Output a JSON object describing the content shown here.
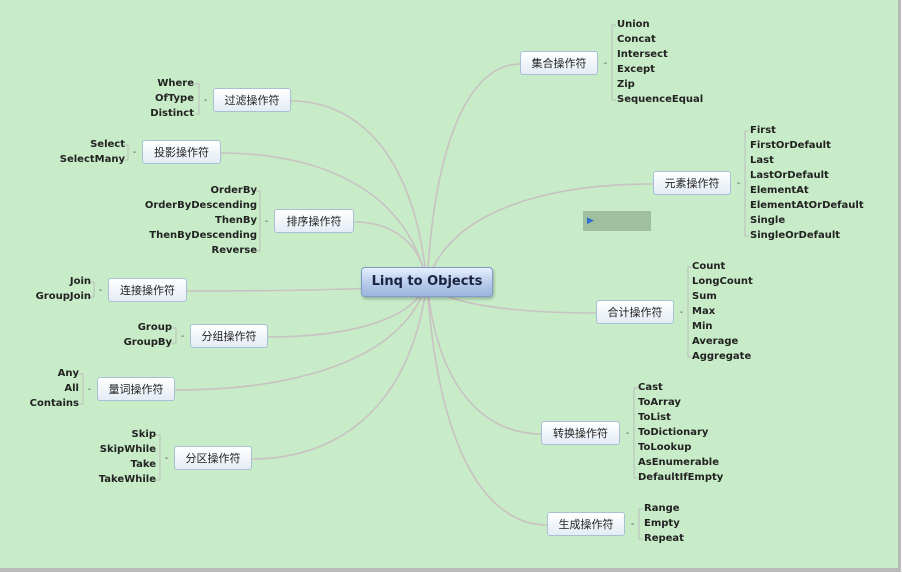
{
  "root": {
    "label": "Linq to Objects"
  },
  "branches": [
    {
      "id": "filter",
      "label": "过滤操作符",
      "side": "left",
      "children": [
        "Where",
        "OfType",
        "Distinct"
      ]
    },
    {
      "id": "projection",
      "label": "投影操作符",
      "side": "left",
      "children": [
        "Select",
        "SelectMany"
      ]
    },
    {
      "id": "sort",
      "label": "排序操作符",
      "side": "left",
      "children": [
        "OrderBy",
        "OrderByDescending",
        "ThenBy",
        "ThenByDescending",
        "Reverse"
      ]
    },
    {
      "id": "join",
      "label": "连接操作符",
      "side": "left",
      "children": [
        "Join",
        "GroupJoin"
      ]
    },
    {
      "id": "group",
      "label": "分组操作符",
      "side": "left",
      "children": [
        "Group",
        "GroupBy"
      ]
    },
    {
      "id": "quantifier",
      "label": "量词操作符",
      "side": "left",
      "children": [
        "Any",
        "All",
        "Contains"
      ]
    },
    {
      "id": "partition",
      "label": "分区操作符",
      "side": "left",
      "children": [
        "Skip",
        "SkipWhile",
        "Take",
        "TakeWhile"
      ]
    },
    {
      "id": "set",
      "label": "集合操作符",
      "side": "right",
      "children": [
        "Union",
        "Concat",
        "Intersect",
        "Except",
        "Zip",
        "SequenceEqual"
      ]
    },
    {
      "id": "element",
      "label": "元素操作符",
      "side": "right",
      "children": [
        "First",
        "FirstOrDefault",
        "Last",
        "LastOrDefault",
        "ElementAt",
        "ElementAtOrDefault",
        "Single",
        "SingleOrDefault"
      ]
    },
    {
      "id": "aggregate",
      "label": "合计操作符",
      "side": "right",
      "children": [
        "Count",
        "LongCount",
        "Sum",
        "Max",
        "Min",
        "Average",
        "Aggregate"
      ]
    },
    {
      "id": "conversion",
      "label": "转换操作符",
      "side": "right",
      "children": [
        "Cast",
        "ToArray",
        "ToList",
        "ToDictionary",
        "ToLookup",
        "AsEnumerable",
        "DefaultIfEmpty"
      ]
    },
    {
      "id": "generation",
      "label": "生成操作符",
      "side": "right",
      "children": [
        "Range",
        "Empty",
        "Repeat"
      ]
    }
  ],
  "colors": {
    "background": "#c8ecc8",
    "link": "#c9c2c2",
    "bracket": "#bcbcbc",
    "node_border": "#a9bfd6",
    "root_fill": "#b6cae9"
  },
  "icons": {
    "collapse": "minus-icon",
    "callout": "play-icon"
  },
  "symbols": {
    "collapse": "-",
    "play": "▶"
  }
}
